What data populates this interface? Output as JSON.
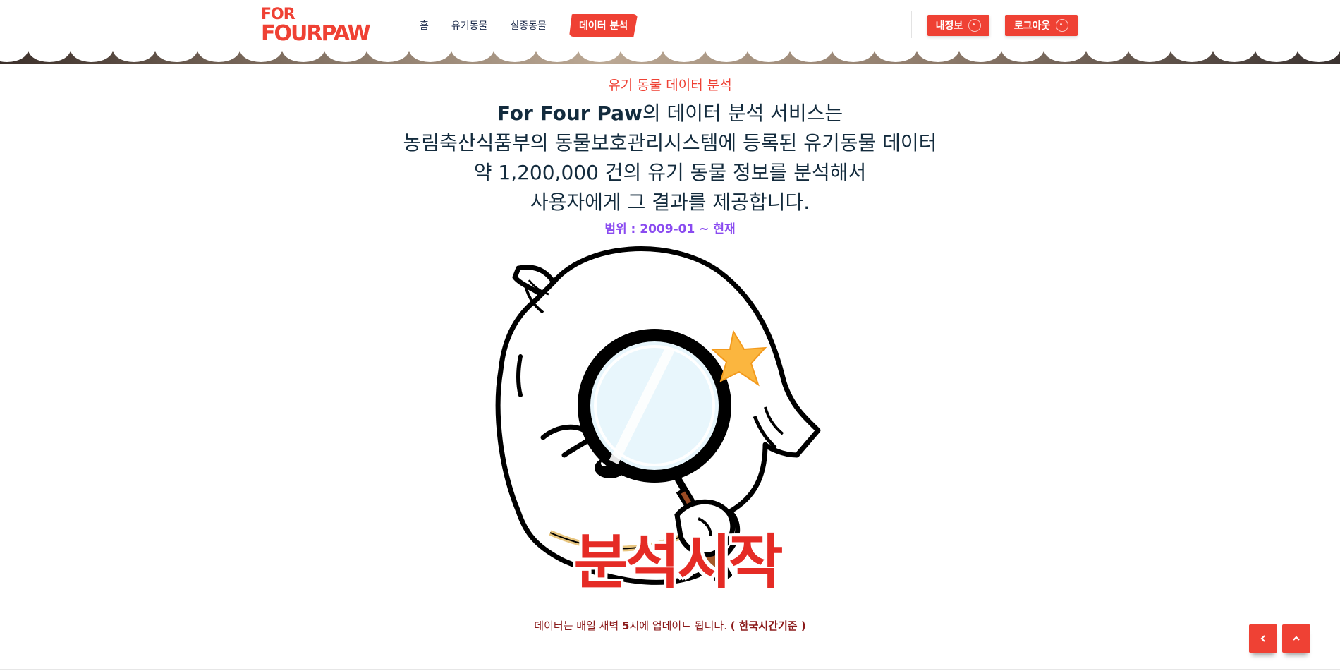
{
  "header": {
    "logo_line1": "FOR",
    "logo_line2": "FOURPAW",
    "nav": [
      {
        "label": "홈",
        "active": false
      },
      {
        "label": "유기동물",
        "active": false
      },
      {
        "label": "실종동물",
        "active": false
      },
      {
        "label": "데이터 분석",
        "active": true
      }
    ],
    "my_info_label": "내정보",
    "logout_label": "로그아웃"
  },
  "main": {
    "subtitle": "유기 동물 데이터 분석",
    "headline": {
      "line1_brand": "For Four Paw",
      "line1_rest": "의 데이터 분석 서비스는",
      "line2": "농림축산식품부의 동물보호관리시스템에 등록된 유기동물 데이터",
      "line3": "약 1,200,000 건의 유기 동물 정보를 분석해서",
      "line4": "사용자에게 그 결과를 제공합니다."
    },
    "range_text": "범위 : 2009-01 ~ 현재",
    "start_button_label": "분석시작",
    "update_note_prefix": "데이터는 매일 새벽 ",
    "update_note_hour": "5",
    "update_note_suffix": "시에 업데이트 됩니다. ",
    "update_note_paren": "( 한국시간기준 )"
  },
  "floating": {
    "back_icon": "chevron-left-icon",
    "top_icon": "chevron-up-icon"
  },
  "colors": {
    "accent": "#ef4134",
    "headline": "#132b3d",
    "range": "#8a4bf0",
    "note": "#8b1a1a"
  }
}
